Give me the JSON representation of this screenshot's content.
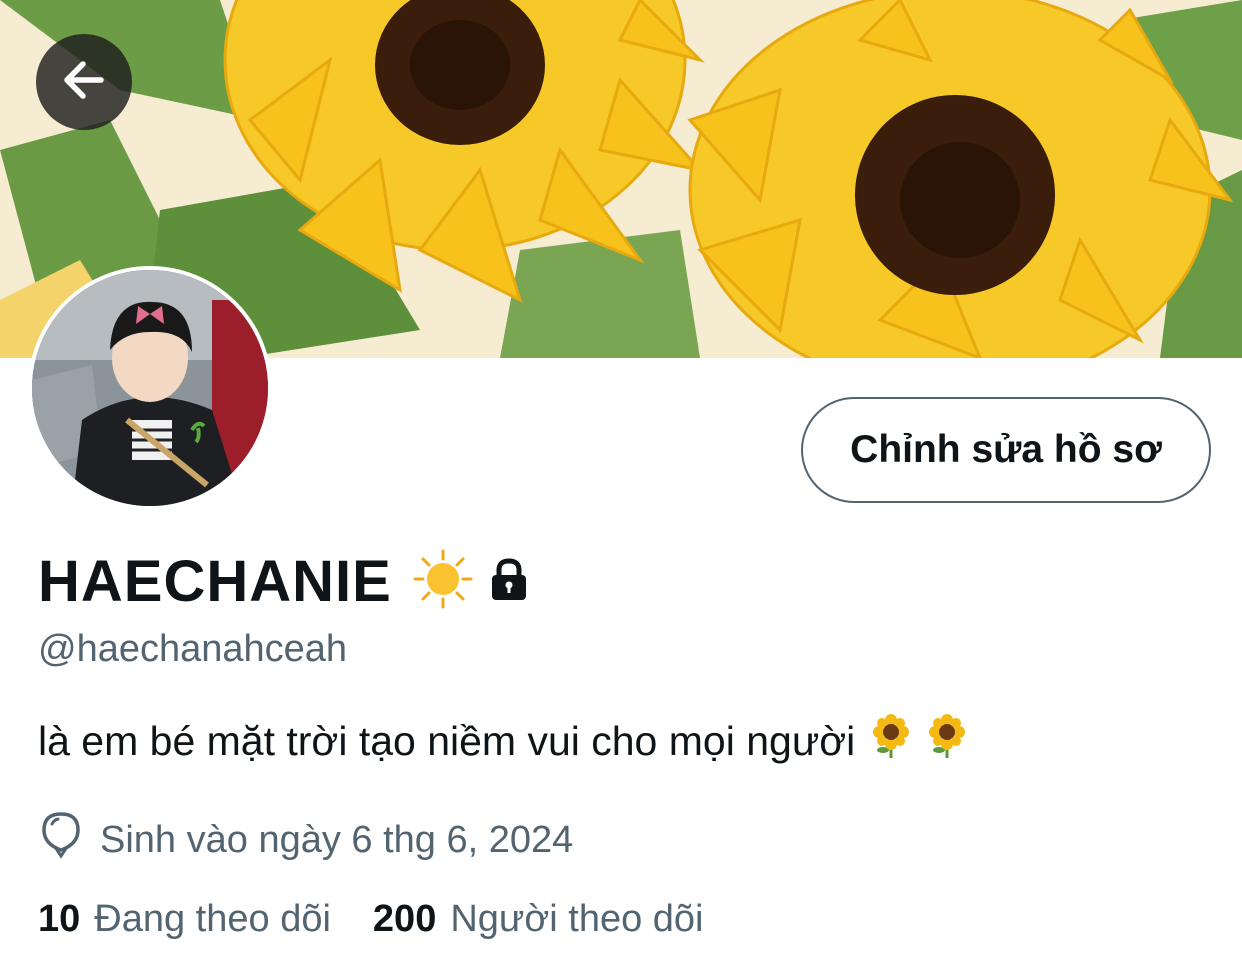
{
  "profile": {
    "display_name": "HAECHANIE",
    "name_emoji": "sun-emoji",
    "protected_icon": "lock-icon",
    "handle": "@haechanahceah",
    "bio": "là em bé mặt trời tạo niềm vui cho mọi người",
    "bio_emojis": [
      "sunflower-emoji",
      "sunflower-emoji"
    ],
    "birthday": "Sinh vào ngày 6 thg 6, 2024",
    "birthday_icon": "balloon-icon"
  },
  "actions": {
    "back_icon": "arrow-left-icon",
    "edit_profile": "Chỉnh sửa hồ sơ"
  },
  "stats": {
    "following_count": "10",
    "following_label": "Đang theo dõi",
    "followers_count": "200",
    "followers_label": "Người theo dõi"
  },
  "colors": {
    "text": "#0f1419",
    "secondary": "#536471",
    "sunflower_petal": "#f6c21b",
    "sunflower_center": "#3a1d0a",
    "leaf": "#6c9c45"
  }
}
